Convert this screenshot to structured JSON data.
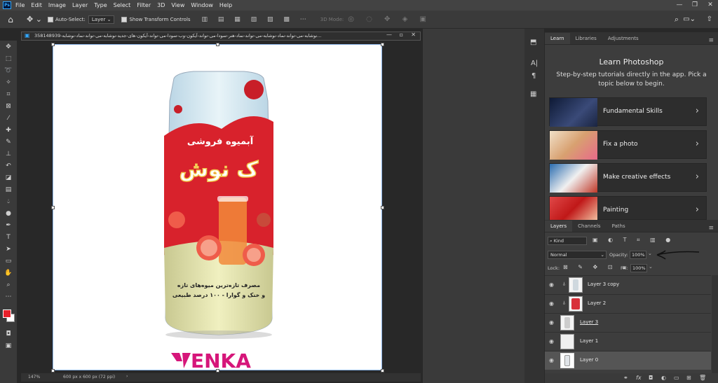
{
  "menu": {
    "app_icon": "Ps",
    "items": [
      "File",
      "Edit",
      "Image",
      "Layer",
      "Type",
      "Select",
      "Filter",
      "3D",
      "View",
      "Window",
      "Help"
    ],
    "window_controls": [
      "—",
      "❐",
      "✕"
    ]
  },
  "options_bar": {
    "auto_select_label": "Auto-Select:",
    "auto_select_target": "Layer",
    "show_transform_label": "Show Transform Controls",
    "mode_3d_label": "3D Mode:"
  },
  "document": {
    "tab_title": "358148939-نوشابه-می-تواند-نماد-نوشابه-می-تواند-نماد-هنر-سودا-می-تواند-آیکون-وب-سودا-می-تواند-آیکون-های-جدید-نوشابه-می-تواند-نماد-نوشابه...",
    "zoom": "147%",
    "doc_info": "600 px x 600 px (72 ppi)"
  },
  "artwork": {
    "can_brand_small": "آبمیوه فروشی",
    "can_brand_big": "ک نوش",
    "can_line1": "مصرف تازه‌ترین میوه‌های تازه",
    "can_line2": "و خنک و گوارا - ۱۰۰ درصد طبیعی",
    "logo_text": "ENKA"
  },
  "learn_panel": {
    "tabs": [
      "Learn",
      "Libraries",
      "Adjustments"
    ],
    "heading": "Learn Photoshop",
    "description": "Step-by-step tutorials directly in the app. Pick a topic below to begin.",
    "cards": [
      {
        "label": "Fundamental Skills",
        "thumb_color": "#1c2a4a"
      },
      {
        "label": "Fix a photo",
        "thumb_color": "#c8a070"
      },
      {
        "label": "Make creative effects",
        "thumb_color": "#b04030"
      },
      {
        "label": "Painting",
        "thumb_color": "#c03030"
      }
    ]
  },
  "layers_panel": {
    "tabs": [
      "Layers",
      "Channels",
      "Paths"
    ],
    "filter_kind": "Kind",
    "blend_mode": "Normal",
    "opacity_label": "Opacity:",
    "opacity_value": "100%",
    "lock_label": "Lock:",
    "fill_label": "Fill:",
    "fill_value": "100%",
    "layers": [
      {
        "name": "Layer 3 copy",
        "selected": false
      },
      {
        "name": "Layer 2",
        "selected": false
      },
      {
        "name": "Layer 3",
        "selected": false
      },
      {
        "name": "Layer 1",
        "selected": false
      },
      {
        "name": "Layer 0",
        "selected": true
      }
    ]
  },
  "colors": {
    "foreground": "#e8202a",
    "background": "#ffffff",
    "accent_blue": "#31a8ff",
    "logo_pink": "#d6167a"
  }
}
